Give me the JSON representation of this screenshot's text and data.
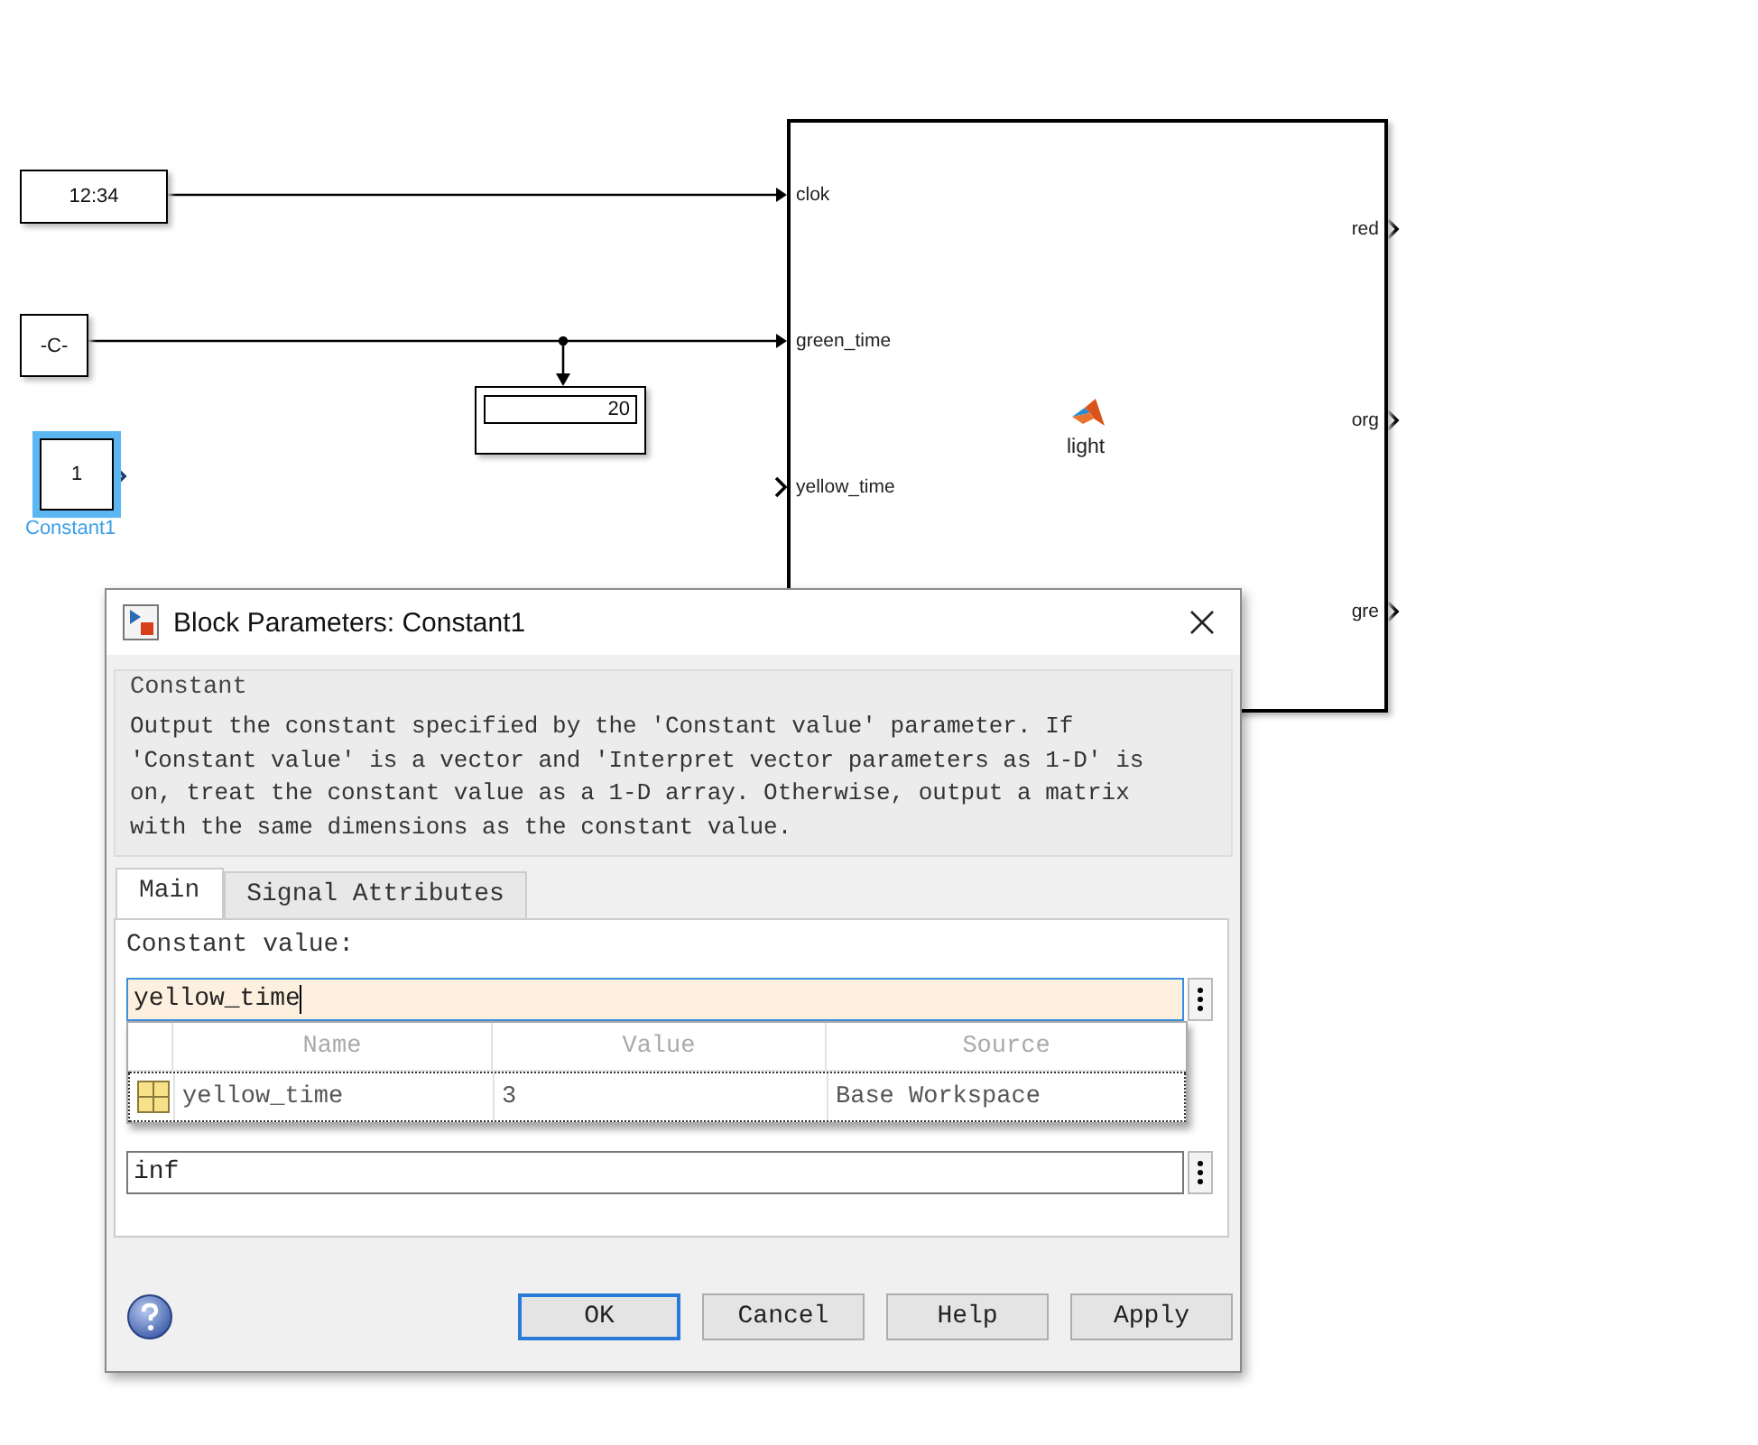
{
  "diagram": {
    "blocks": [
      {
        "kind": "clock",
        "text": "12:34"
      },
      {
        "kind": "constant",
        "text": "-C-"
      },
      {
        "kind": "display",
        "text": "20"
      },
      {
        "kind": "constant",
        "text": "1",
        "label": "Constant1",
        "selected": true
      }
    ],
    "chart_block": {
      "name": "light",
      "inputs": [
        "clok",
        "green_time",
        "yellow_time"
      ],
      "outputs": [
        "red",
        "org",
        "gre"
      ]
    }
  },
  "dialog": {
    "title": "Block Parameters: Constant1",
    "group": "Constant",
    "description": "Output the constant specified by the 'Constant value' parameter. If 'Constant value' is a vector and 'Interpret vector parameters as 1-D' is on, treat the constant value as a 1-D array. Otherwise, output a matrix with the same dimensions as the constant value.",
    "tabs": [
      {
        "label": "Main",
        "selected": true
      },
      {
        "label": "Signal Attributes",
        "selected": false
      }
    ],
    "fields": [
      {
        "label": "Constant value:",
        "value": "yellow_time",
        "focused": true
      },
      {
        "value": "inf",
        "focused": false
      }
    ],
    "suggestions": {
      "columns": [
        "Name",
        "Value",
        "Source"
      ],
      "rows": [
        {
          "name": "yellow_time",
          "value": "3",
          "source": "Base Workspace",
          "selected": true
        }
      ]
    },
    "buttons": [
      {
        "label": "OK",
        "default": true
      },
      {
        "label": "Cancel",
        "default": false
      },
      {
        "label": "Help",
        "default": false
      },
      {
        "label": "Apply",
        "default": false
      }
    ]
  }
}
